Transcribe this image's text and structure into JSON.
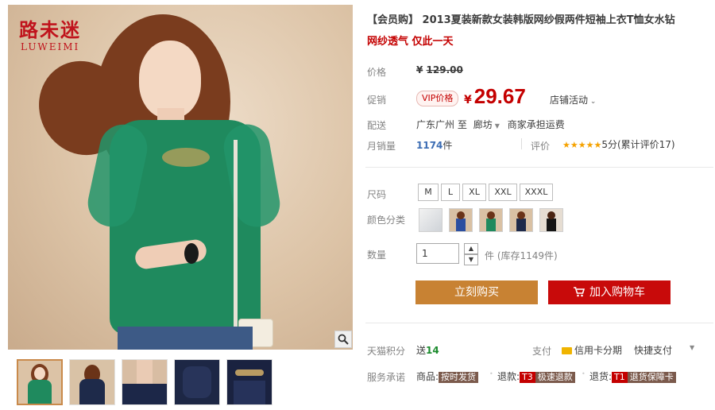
{
  "brand": {
    "name_cn": "路未迷",
    "name_en": "LUWEIMI"
  },
  "title": "【会员购】 2013夏装新款女装韩版网纱假两件短袖上衣T恤女水钻",
  "subtitle": "网纱透气 仅此一天",
  "price": {
    "label": "价格",
    "currency": "¥",
    "original": "129.00"
  },
  "promo": {
    "label": "促销",
    "badge": "VIP价格",
    "currency": "¥",
    "value": "29.67",
    "shop_activity": "店铺活动"
  },
  "delivery": {
    "label": "配送",
    "from": "广东广州",
    "to_word": "至",
    "to": "廊坊",
    "fee": "商家承担运费"
  },
  "sales": {
    "label": "月销量",
    "count": "1174",
    "unit": "件"
  },
  "rating": {
    "label": "评价",
    "stars": "★★★★★",
    "score_text": "5分(累计评价17)",
    "score": 5
  },
  "size": {
    "label": "尺码",
    "options": [
      "M",
      "L",
      "XL",
      "XXL",
      "XXXL"
    ]
  },
  "color": {
    "label": "颜色分类"
  },
  "quantity": {
    "label": "数量",
    "value": "1",
    "stock_text": "件 (库存1149件)"
  },
  "buttons": {
    "buy_now": "立刻购买",
    "add_cart": "加入购物车"
  },
  "points": {
    "label": "天猫积分",
    "prefix": "送",
    "value": "14"
  },
  "payment": {
    "label": "支付",
    "card": "信用卡分期",
    "quick": "快捷支付"
  },
  "service": {
    "label": "服务承诺",
    "items": [
      {
        "prefix": "商品:",
        "tag": "按时发货"
      },
      {
        "prefix": "退款:",
        "tag_code": "T3",
        "tag": "极速退款"
      },
      {
        "prefix": "退货:",
        "tag_code": "T1",
        "tag": "退货保障卡"
      }
    ]
  },
  "colors": {
    "brand_red": "#c0131c",
    "price_red": "#c40000",
    "buy_now": "#c88233",
    "add_cart": "#c80a0a",
    "points_green": "#1a8a2c",
    "sales_blue": "#3b6cb3",
    "star_yellow": "#f5a200"
  }
}
